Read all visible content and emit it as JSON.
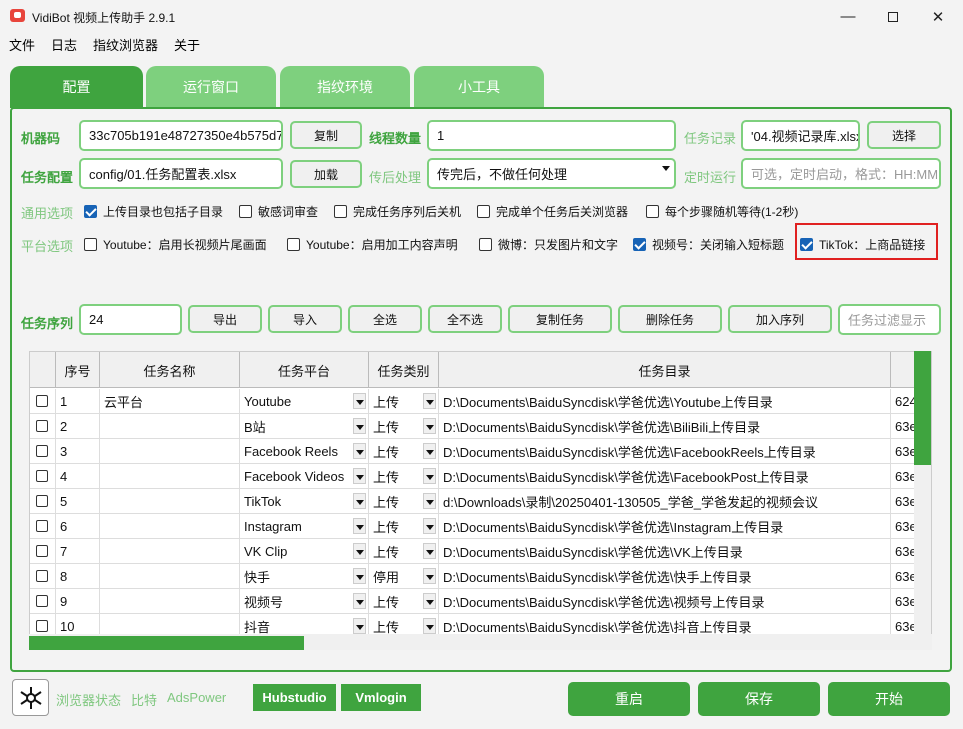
{
  "window": {
    "title": "VidiBot 视频上传助手 2.9.1"
  },
  "menu": [
    "文件",
    "日志",
    "指纹浏览器",
    "关于"
  ],
  "tabs": [
    "配置",
    "运行窗口",
    "指纹环境",
    "小工具"
  ],
  "config": {
    "machine_code_label": "机器码",
    "machine_code_value": "33c705b191e48727350e4b575d7",
    "copy_label": "复制",
    "threads_label": "线程数量",
    "threads_value": "1",
    "task_record_label": "任务记录",
    "task_record_value": "'04.视频记录库.xlsx",
    "select_label": "选择",
    "task_config_label": "任务配置",
    "task_config_value": "config/01.任务配置表.xlsx",
    "load_label": "加载",
    "post_process_label": "传后处理",
    "post_process_value": "传完后，不做任何处理",
    "schedule_label": "定时运行",
    "schedule_placeholder": "可选，定时启动，格式：HH:MM",
    "general_options_label": "通用选项",
    "platform_options_label": "平台选项",
    "general_options": [
      {
        "label": "上传目录也包括子目录",
        "checked": true
      },
      {
        "label": "敏感词审查",
        "checked": false
      },
      {
        "label": "完成任务序列后关机",
        "checked": false
      },
      {
        "label": "完成单个任务后关浏览器",
        "checked": false
      },
      {
        "label": "每个步骤随机等待(1-2秒)",
        "checked": false
      }
    ],
    "platform_options": [
      {
        "label": "Youtube：启用长视频片尾画面",
        "checked": false
      },
      {
        "label": "Youtube：启用加工内容声明",
        "checked": false
      },
      {
        "label": "微博：只发图片和文字",
        "checked": false
      },
      {
        "label": "视频号：关闭输入短标题",
        "checked": true
      },
      {
        "label": "TikTok：上商品链接",
        "checked": true
      }
    ]
  },
  "sequence": {
    "label": "任务序列",
    "value": "24",
    "buttons": [
      "导出",
      "导入",
      "全选",
      "全不选",
      "复制任务",
      "删除任务",
      "加入序列"
    ],
    "filter_placeholder": "任务过滤显示"
  },
  "table": {
    "headers": [
      "序号",
      "任务名称",
      "任务平台",
      "任务类别",
      "任务目录"
    ],
    "rows": [
      {
        "no": "1",
        "name": "云平台",
        "platform": "Youtube",
        "type": "上传",
        "dir": "D:\\Documents\\BaiduSyncdisk\\学爸优选\\Youtube上传目录",
        "extra": "624"
      },
      {
        "no": "2",
        "name": "",
        "platform": "B站",
        "type": "上传",
        "dir": "D:\\Documents\\BaiduSyncdisk\\学爸优选\\BiliBili上传目录",
        "extra": "63e"
      },
      {
        "no": "3",
        "name": "",
        "platform": "Facebook Reels",
        "type": "上传",
        "dir": "D:\\Documents\\BaiduSyncdisk\\学爸优选\\FacebookReels上传目录",
        "extra": "63e"
      },
      {
        "no": "4",
        "name": "",
        "platform": "Facebook Videos",
        "type": "上传",
        "dir": "D:\\Documents\\BaiduSyncdisk\\学爸优选\\FacebookPost上传目录",
        "extra": "63e"
      },
      {
        "no": "5",
        "name": "",
        "platform": "TikTok",
        "type": "上传",
        "dir": "d:\\Downloads\\录制\\20250401-130505_学爸_学爸发起的视频会议",
        "extra": "63e"
      },
      {
        "no": "6",
        "name": "",
        "platform": "Instagram",
        "type": "上传",
        "dir": "D:\\Documents\\BaiduSyncdisk\\学爸优选\\Instagram上传目录",
        "extra": "63e"
      },
      {
        "no": "7",
        "name": "",
        "platform": "VK Clip",
        "type": "上传",
        "dir": "D:\\Documents\\BaiduSyncdisk\\学爸优选\\VK上传目录",
        "extra": "63e"
      },
      {
        "no": "8",
        "name": "",
        "platform": "快手",
        "type": "停用",
        "dir": "D:\\Documents\\BaiduSyncdisk\\学爸优选\\快手上传目录",
        "extra": "63e"
      },
      {
        "no": "9",
        "name": "",
        "platform": "视频号",
        "type": "上传",
        "dir": "D:\\Documents\\BaiduSyncdisk\\学爸优选\\视频号上传目录",
        "extra": "63e"
      },
      {
        "no": "10",
        "name": "",
        "platform": "抖音",
        "type": "上传",
        "dir": "D:\\Documents\\BaiduSyncdisk\\学爸优选\\抖音上传目录",
        "extra": "63e"
      }
    ]
  },
  "footer": {
    "browser_status_label": "浏览器状态",
    "bitbrowser_label": "比特",
    "adspower_label": "AdsPower",
    "hubstudio_label": "Hubstudio",
    "vmlogin_label": "Vmlogin",
    "restart_label": "重启",
    "save_label": "保存",
    "start_label": "开始"
  },
  "colors": {
    "accent": "#3fa43f",
    "accent_light": "#7ed07e",
    "highlight": "#e02020"
  }
}
